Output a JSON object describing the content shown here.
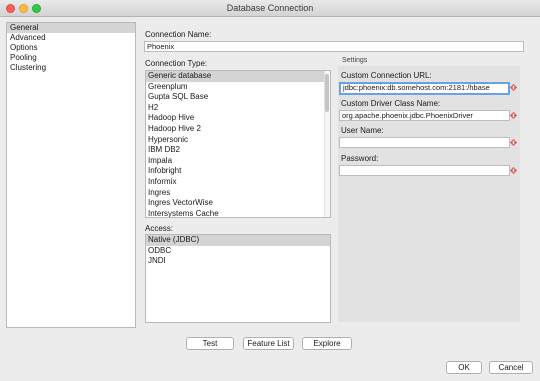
{
  "window": {
    "title": "Database Connection"
  },
  "sidebar": {
    "items": [
      {
        "label": "General",
        "selected": true
      },
      {
        "label": "Advanced",
        "selected": false
      },
      {
        "label": "Options",
        "selected": false
      },
      {
        "label": "Pooling",
        "selected": false
      },
      {
        "label": "Clustering",
        "selected": false
      }
    ]
  },
  "connection_name": {
    "label": "Connection Name:",
    "value": "Phoenix"
  },
  "connection_type": {
    "label": "Connection Type:",
    "selected": "Generic database",
    "options": [
      "Generic database",
      "Greenplum",
      "Gupta SQL Base",
      "H2",
      "Hadoop Hive",
      "Hadoop Hive 2",
      "Hypersonic",
      "IBM DB2",
      "Impala",
      "Infobright",
      "Informix",
      "Ingres",
      "Ingres VectorWise",
      "Intersystems Cache"
    ]
  },
  "access": {
    "label": "Access:",
    "selected": "Native (JDBC)",
    "options": [
      "Native (JDBC)",
      "ODBC",
      "JNDI"
    ]
  },
  "settings": {
    "label": "Settings",
    "url": {
      "label": "Custom Connection URL:",
      "value": "jdbc:phoenix:db.somehost.com:2181:/hbase"
    },
    "driver": {
      "label": "Custom Driver Class Name:",
      "value": "org.apache.phoenix.jdbc.PhoenixDriver"
    },
    "user": {
      "label": "User Name:",
      "value": ""
    },
    "password": {
      "label": "Password:",
      "value": ""
    }
  },
  "buttons": {
    "test": "Test",
    "feature_list": "Feature List",
    "explore": "Explore",
    "ok": "OK",
    "cancel": "Cancel"
  },
  "colors": {
    "variable_icon": "#d9534f",
    "focus_ring": "#6aa1e2",
    "selection": "#d4d4d4"
  }
}
